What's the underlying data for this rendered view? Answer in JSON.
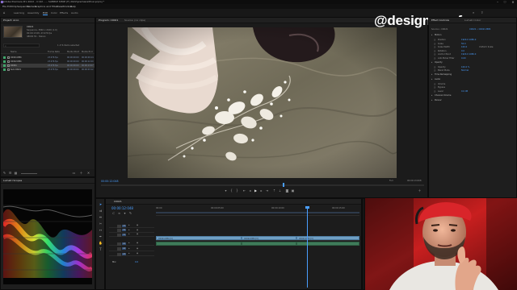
{
  "window": {
    "title": "Adobe Premiere Pro 2022 - C:\\02 - ... SAMPLE SHOP (F) 2022\\premiere\\final.prproj *",
    "app_icon": "premiere-pro-icon"
  },
  "menu": [
    "File",
    "Edit",
    "Clip",
    "Sequence",
    "Markers",
    "Graphics and Titles",
    "View",
    "Window",
    "Help"
  ],
  "workspaces": [
    "Learning",
    "Assembly",
    "Edit",
    "Color",
    "Effects",
    "Audio"
  ],
  "active_workspace": "Edit",
  "project_panel": {
    "tab": "Project: Acco",
    "clip_name": "C0021",
    "clip_info_lines": [
      "Sequence, 3840 x 2160 (1.0)",
      "00:00:13:08, 23.976 fps",
      "48000 Hz - Stereo"
    ],
    "item_count": "1 of 6 items selected",
    "columns": [
      "Name",
      "Frame Rate",
      "Media Start",
      "Media End"
    ],
    "items": [
      {
        "name": "C0021.MP4",
        "rate": "23.976 fps",
        "start": "00:00:00:00",
        "end": "00:00:09:14",
        "color": "#3fa56a"
      },
      {
        "name": "C0022.MP4",
        "rate": "23.976 fps",
        "start": "00:00:00:00",
        "end": "00:00:12:20",
        "color": "#3fa56a"
      },
      {
        "name": "C0021",
        "rate": "23.976 fps",
        "start": "00:00:00:00",
        "end": "00:00:13:07",
        "color": "#3fa56a",
        "selected": true
      },
      {
        "name": "Sub C0021",
        "rate": "23.976 fps",
        "start": "00:00:00:00",
        "end": "00:00:03:12",
        "color": "#3fa56a"
      }
    ]
  },
  "lumetri_panel": {
    "tab": "Lumetri Scopes"
  },
  "program_monitor": {
    "tabs": [
      "Program: C0021",
      "Source: (no clips)"
    ],
    "timecode": "00:00:12:048",
    "fit": "Full",
    "duration": "00:00:13:008"
  },
  "watermark": "@designeemfoco",
  "effect_controls": {
    "tabs": [
      "Effect Controls",
      "Lumetri Color"
    ],
    "source_label": "Source • C0021",
    "sequence_label": "C0021 • C0021.MP4",
    "sections": [
      "Motion",
      "Position",
      "Scale",
      "Scale Width",
      "Rotation",
      "Anchor Point",
      "Anti-flicker Filter",
      "Opacity",
      "Opacity",
      "Blend Mode",
      "Time Remapping",
      "Audio",
      "Volume",
      "Bypass",
      "Level",
      "Channel Volume",
      "Panner"
    ],
    "values": {
      "position": "1920.0  1080.0",
      "scale": "50.0",
      "scale_width": "100.0",
      "uniform_scale": "Uniform Scale",
      "rotation": "0.0",
      "anchor": "1920.0  1080.0",
      "antiflicker": "0.00",
      "opacity": "100.0 %",
      "blend_mode": "Normal",
      "level": "0.0 dB"
    }
  },
  "timeline": {
    "tab": "C0021",
    "timecode": "00:00:12:048",
    "ruler_labels": [
      "00:00",
      "00:00:05:00",
      "00:00:10:00",
      "00:00:15:00"
    ],
    "video_tracks": [
      "V3",
      "V2",
      "V1"
    ],
    "audio_tracks": [
      "A1",
      "A2",
      "A3"
    ],
    "master_label": "Mix",
    "master_value": "0.0",
    "clips": [
      {
        "label": "C0021.MP4 [V]"
      },
      {
        "label": "C0022.MP4 [V]"
      },
      {
        "label": "C0021.MP4 [V]"
      }
    ]
  },
  "colors": {
    "accent": "#4a9eff",
    "clip_video": "#6f9fc4",
    "clip_label": "#9b8fc9",
    "playhead": "#4a9eff"
  }
}
